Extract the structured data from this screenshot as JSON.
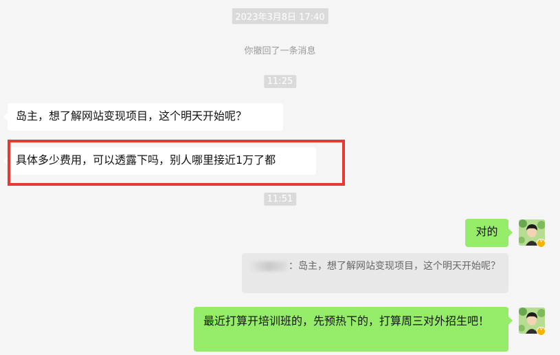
{
  "timestamps": {
    "top": "2023年3月8日 17:40",
    "first": "11:25",
    "second": "11:51"
  },
  "system_notice": "你撤回了一条消息",
  "messages": {
    "incoming_1": "岛主，想了解网站变现项目，这个明天开始呢？",
    "incoming_2": "具体多少费用，可以透露下吗，别人哪里接近1万了都",
    "outgoing_1": "对的",
    "quote": "：岛主，想了解网站变现项目，这个明天开始呢？",
    "outgoing_2": "最近打算开培训班的，先预热下的，打算周三对外招生吧！"
  },
  "colors": {
    "background": "#f5f5f5",
    "incoming_bubble": "#ffffff",
    "outgoing_bubble": "#95ec69",
    "highlight_border": "#e53935"
  }
}
